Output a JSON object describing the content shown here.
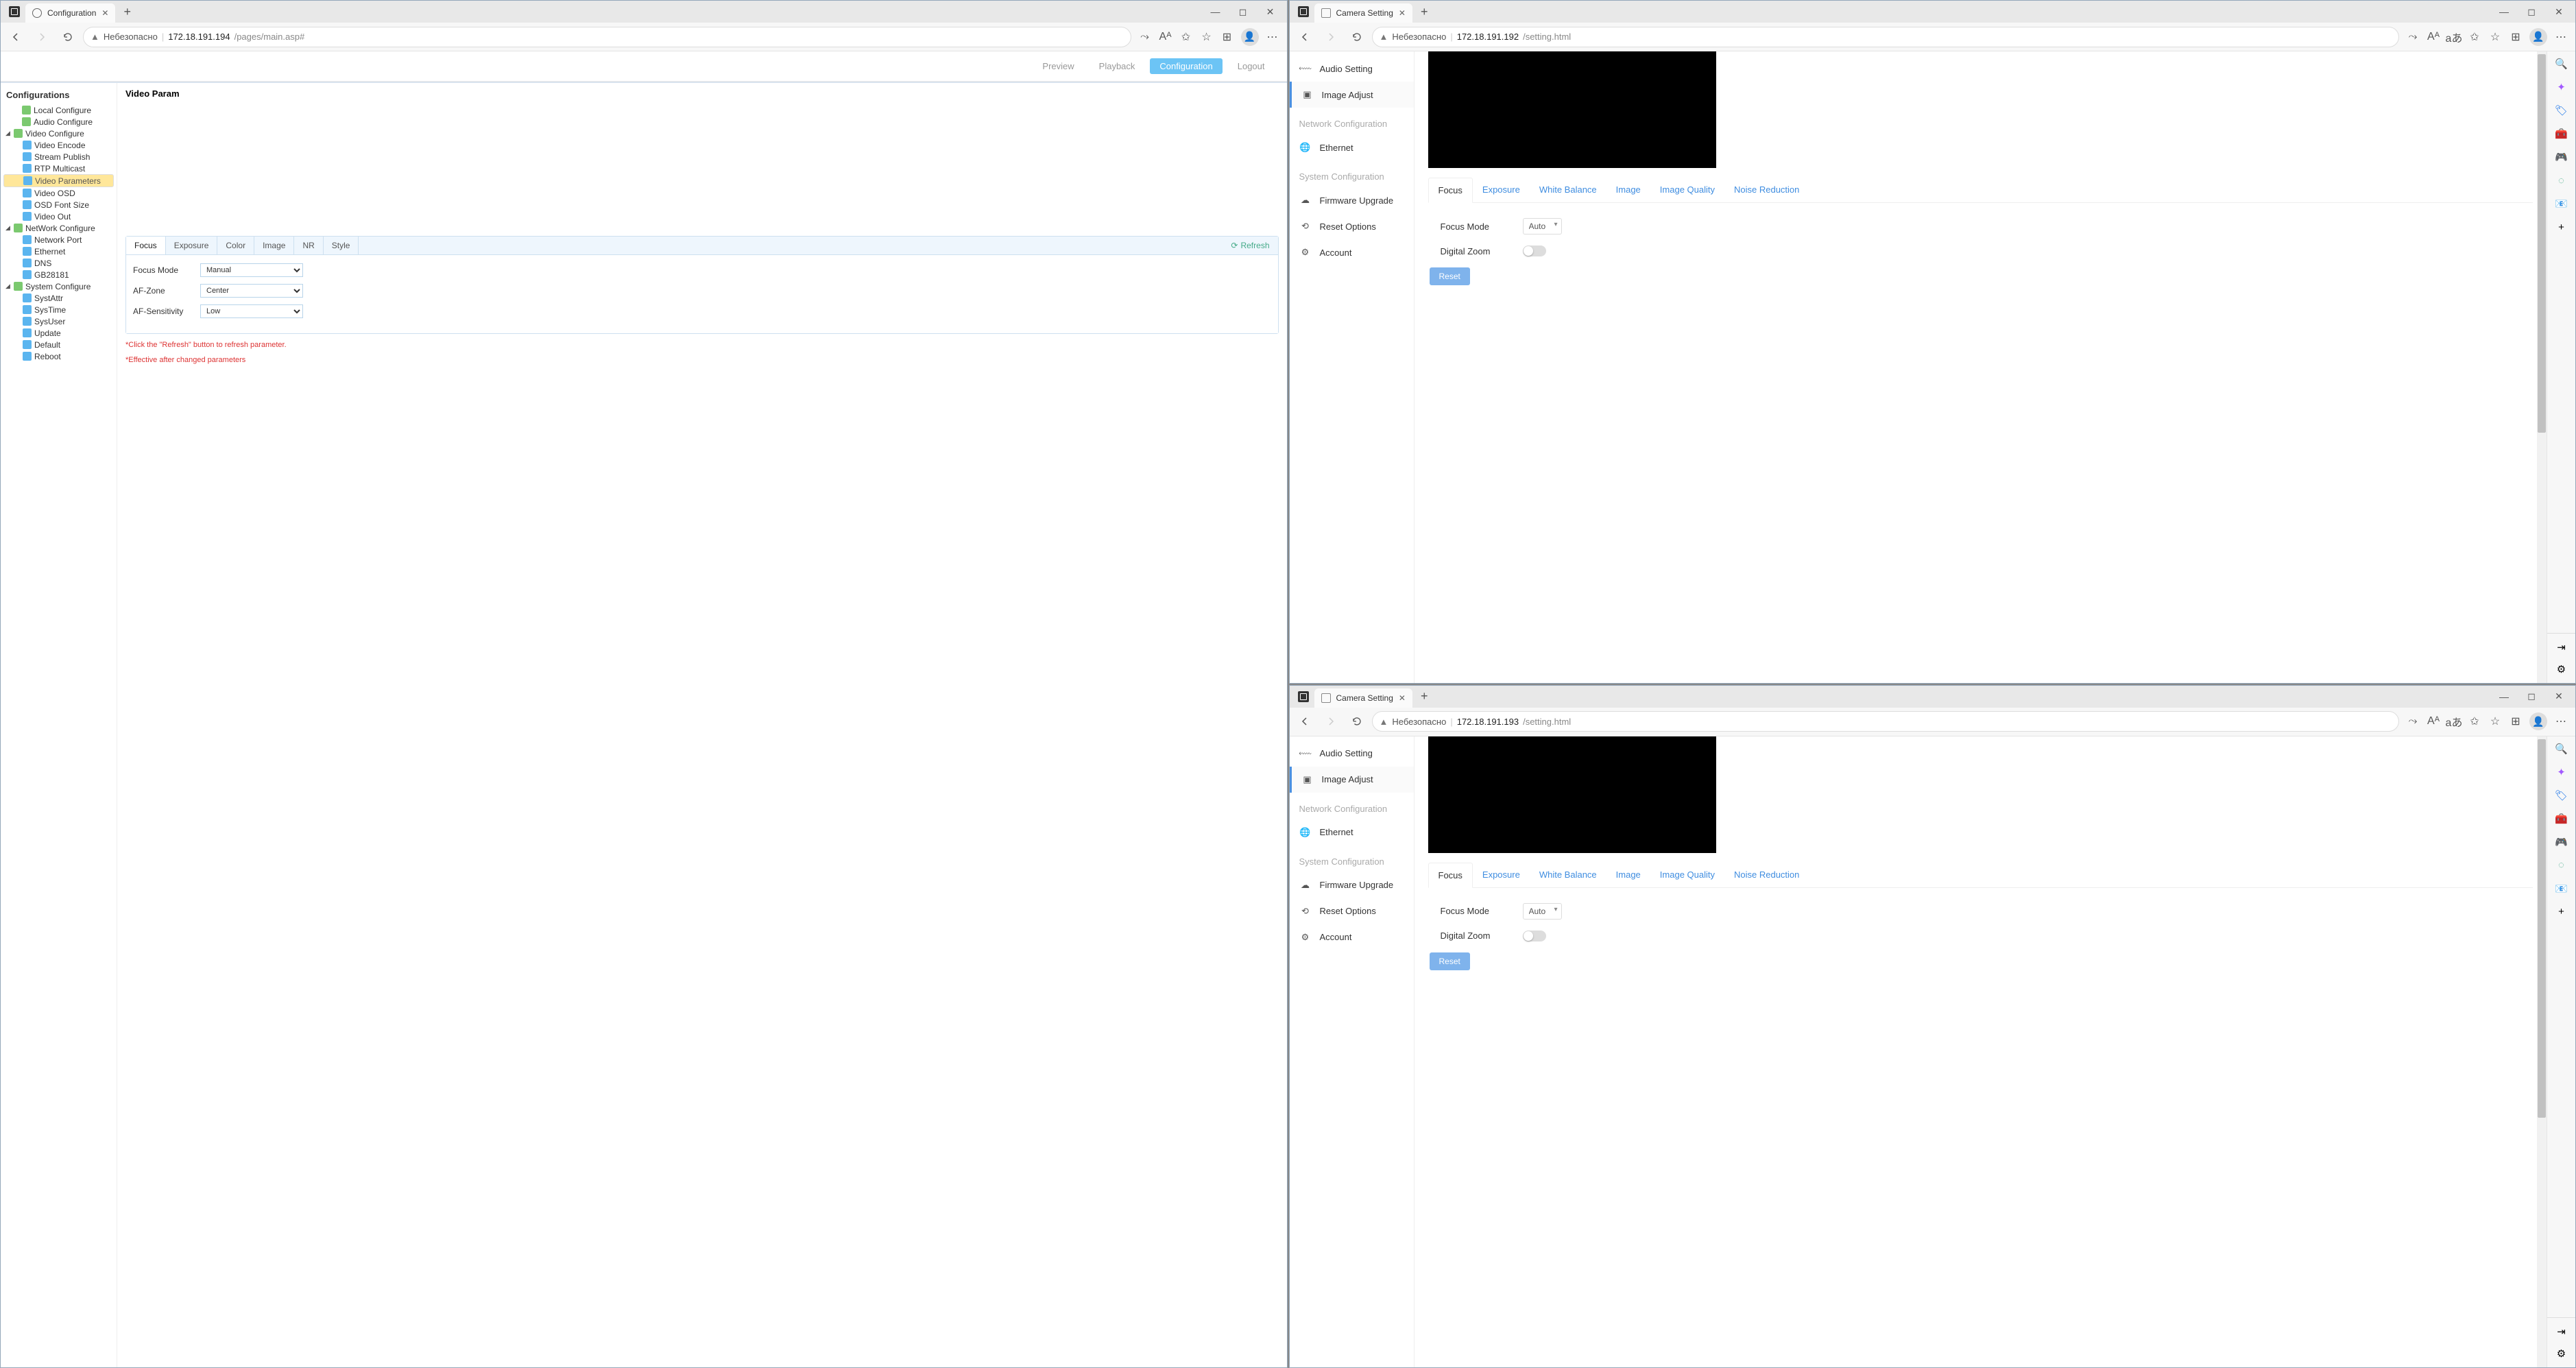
{
  "windows": {
    "topLeft": {
      "tabTitle": "Camera Setting",
      "security": "Небезопасно",
      "host": "172.18.191.192",
      "path": "/setting.html"
    },
    "bottomLeft": {
      "tabTitle": "Camera Setting",
      "security": "Небезопасно",
      "host": "172.18.191.193",
      "path": "/setting.html"
    },
    "right": {
      "tabTitle": "Configuration",
      "security": "Небезопасно",
      "host": "172.18.191.194",
      "path": "/pages/main.asp#"
    }
  },
  "cameraNav": {
    "audio": "Audio Setting",
    "imageAdjust": "Image Adjust",
    "netSection": "Network Configuration",
    "ethernet": "Ethernet",
    "sysSection": "System Configuration",
    "firmware": "Firmware Upgrade",
    "reset": "Reset Options",
    "account": "Account"
  },
  "cameraTabs": {
    "focus": "Focus",
    "exposure": "Exposure",
    "wb": "White Balance",
    "image": "Image",
    "iq": "Image Quality",
    "nr": "Noise Reduction"
  },
  "cameraForm": {
    "focusModeLabel": "Focus Mode",
    "focusModeValue": "Auto",
    "digitalZoomLabel": "Digital Zoom",
    "resetBtn": "Reset"
  },
  "cfg": {
    "topbar": {
      "preview": "Preview",
      "playback": "Playback",
      "configuration": "Configuration",
      "logout": "Logout"
    },
    "treeTitle": "Configurations",
    "tree": {
      "local": "Local Configure",
      "audio": "Audio Configure",
      "video": "Video Configure",
      "vEncode": "Video Encode",
      "vStream": "Stream Publish",
      "vRtp": "RTP Multicast",
      "vParam": "Video Parameters",
      "vOsd": "Video OSD",
      "vFont": "OSD Font Size",
      "vOut": "Video Out",
      "net": "NetWork Configure",
      "nPort": "Network Port",
      "nEth": "Ethernet",
      "nDns": "DNS",
      "nGb": "GB28181",
      "sys": "System Configure",
      "sAttr": "SystAttr",
      "sTime": "SysTime",
      "sUser": "SysUser",
      "sUpdate": "Update",
      "sDefault": "Default",
      "sReboot": "Reboot"
    },
    "mainTitle": "Video Param",
    "ptabs": {
      "focus": "Focus",
      "exposure": "Exposure",
      "color": "Color",
      "image": "Image",
      "nr": "NR",
      "style": "Style",
      "refresh": "Refresh"
    },
    "params": {
      "focusModeL": "Focus Mode",
      "focusModeV": "Manual",
      "afZoneL": "AF-Zone",
      "afZoneV": "Center",
      "afSensL": "AF-Sensitivity",
      "afSensV": "Low"
    },
    "hint1": "*Click the \"Refresh\" button to refresh parameter.",
    "hint2": "*Effective after changed parameters"
  }
}
